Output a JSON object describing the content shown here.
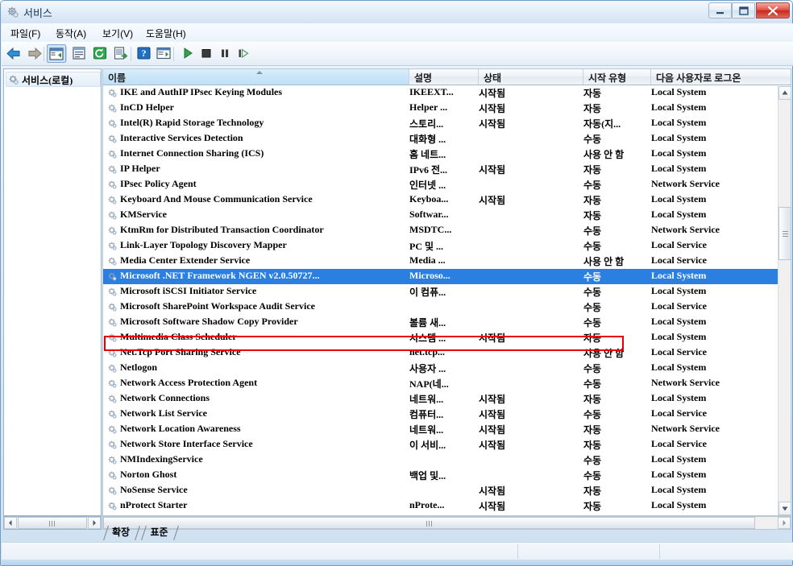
{
  "window": {
    "title": "서비스",
    "title_icon": "services-gear-icon",
    "buttons": {
      "minimize": "minimize-icon",
      "maximize": "maximize-icon",
      "close": "close-icon"
    }
  },
  "menubar": {
    "items": [
      {
        "label": "파일(F)",
        "name": "menu-file"
      },
      {
        "label": "동작(A)",
        "name": "menu-action"
      },
      {
        "label": "보기(V)",
        "name": "menu-view"
      },
      {
        "label": "도움말(H)",
        "name": "menu-help"
      }
    ]
  },
  "toolbar": {
    "buttons": [
      {
        "name": "back-button",
        "icon": "arrow-left-icon"
      },
      {
        "name": "forward-button",
        "icon": "arrow-right-icon"
      },
      {
        "name": "show-hide-tree-button",
        "icon": "tree-pane-icon"
      },
      {
        "name": "properties-button",
        "icon": "properties-icon"
      },
      {
        "name": "refresh-button",
        "icon": "refresh-icon"
      },
      {
        "name": "export-list-button",
        "icon": "export-list-icon"
      },
      {
        "name": "help-button",
        "icon": "help-question-icon"
      },
      {
        "name": "show-action-pane-button",
        "icon": "action-pane-icon"
      },
      {
        "name": "start-service-button",
        "icon": "play-icon"
      },
      {
        "name": "stop-service-button",
        "icon": "stop-icon"
      },
      {
        "name": "pause-service-button",
        "icon": "pause-icon"
      },
      {
        "name": "restart-service-button",
        "icon": "restart-icon"
      }
    ]
  },
  "tree": {
    "root_label": "서비스(로컬)",
    "root_icon": "services-gear-icon"
  },
  "list": {
    "columns": [
      {
        "label": "이름",
        "name": "column-name",
        "sorted": true
      },
      {
        "label": "설명",
        "name": "column-description",
        "sorted": false
      },
      {
        "label": "상태",
        "name": "column-status",
        "sorted": false
      },
      {
        "label": "시작 유형",
        "name": "column-startup-type",
        "sorted": false
      },
      {
        "label": "다음 사용자로 로그온",
        "name": "column-log-on-as",
        "sorted": false
      }
    ],
    "rows": [
      {
        "name": "IKE and AuthIP IPsec Keying Modules",
        "description": "IKEEXT...",
        "status": "시작됨",
        "startup": "자동",
        "logon": "Local System",
        "selected": false
      },
      {
        "name": "InCD Helper",
        "description": "Helper ...",
        "status": "시작됨",
        "startup": "자동",
        "logon": "Local System",
        "selected": false
      },
      {
        "name": "Intel(R) Rapid Storage Technology",
        "description": "스토리...",
        "status": "시작됨",
        "startup": "자동(지...",
        "logon": "Local System",
        "selected": false
      },
      {
        "name": "Interactive Services Detection",
        "description": "대화형 ...",
        "status": "",
        "startup": "수동",
        "logon": "Local System",
        "selected": false
      },
      {
        "name": "Internet Connection Sharing (ICS)",
        "description": "홈 네트...",
        "status": "",
        "startup": "사용 안 함",
        "logon": "Local System",
        "selected": false
      },
      {
        "name": "IP Helper",
        "description": "IPv6 전...",
        "status": "시작됨",
        "startup": "자동",
        "logon": "Local System",
        "selected": false
      },
      {
        "name": "IPsec Policy Agent",
        "description": "인터넷 ...",
        "status": "",
        "startup": "수동",
        "logon": "Network Service",
        "selected": false
      },
      {
        "name": "Keyboard And Mouse Communication Service",
        "description": "Keyboa...",
        "status": "시작됨",
        "startup": "자동",
        "logon": "Local System",
        "selected": false
      },
      {
        "name": "KMService",
        "description": "Softwar...",
        "status": "",
        "startup": "자동",
        "logon": "Local System",
        "selected": false
      },
      {
        "name": "KtmRm for Distributed Transaction Coordinator",
        "description": "MSDTC...",
        "status": "",
        "startup": "수동",
        "logon": "Network Service",
        "selected": false
      },
      {
        "name": "Link-Layer Topology Discovery Mapper",
        "description": "PC 및 ...",
        "status": "",
        "startup": "수동",
        "logon": "Local Service",
        "selected": false
      },
      {
        "name": "Media Center Extender Service",
        "description": "Media ...",
        "status": "",
        "startup": "사용 안 함",
        "logon": "Local Service",
        "selected": false
      },
      {
        "name": "Microsoft .NET Framework NGEN v2.0.50727...",
        "description": "Microso...",
        "status": "",
        "startup": "수동",
        "logon": "Local System",
        "selected": true
      },
      {
        "name": "Microsoft iSCSI Initiator Service",
        "description": "이 컴퓨...",
        "status": "",
        "startup": "수동",
        "logon": "Local System",
        "selected": false
      },
      {
        "name": "Microsoft SharePoint Workspace Audit Service",
        "description": "",
        "startup": "수동",
        "status": "",
        "logon": "Local Service",
        "selected": false
      },
      {
        "name": "Microsoft Software Shadow Copy Provider",
        "description": "볼륨 새...",
        "status": "",
        "startup": "수동",
        "logon": "Local System",
        "selected": false
      },
      {
        "name": "Multimedia Class Scheduler",
        "description": "시스템 ...",
        "status": "시작됨",
        "startup": "자동",
        "logon": "Local System",
        "selected": false
      },
      {
        "name": "Net.Tcp Port Sharing Service",
        "description": "net.tcp...",
        "status": "",
        "startup": "사용 안 함",
        "logon": "Local Service",
        "selected": false
      },
      {
        "name": "Netlogon",
        "description": "사용자 ...",
        "status": "",
        "startup": "수동",
        "logon": "Local System",
        "selected": false
      },
      {
        "name": "Network Access Protection Agent",
        "description": "NAP(네...",
        "status": "",
        "startup": "수동",
        "logon": "Network Service",
        "selected": false
      },
      {
        "name": "Network Connections",
        "description": "네트워...",
        "status": "시작됨",
        "startup": "자동",
        "logon": "Local System",
        "selected": false
      },
      {
        "name": "Network List Service",
        "description": "컴퓨터...",
        "status": "시작됨",
        "startup": "수동",
        "logon": "Local Service",
        "selected": false
      },
      {
        "name": "Network Location Awareness",
        "description": "네트워...",
        "status": "시작됨",
        "startup": "자동",
        "logon": "Network Service",
        "selected": false
      },
      {
        "name": "Network Store Interface Service",
        "description": "이 서비...",
        "status": "시작됨",
        "startup": "자동",
        "logon": "Local Service",
        "selected": false
      },
      {
        "name": "NMIndexingService",
        "description": "",
        "status": "",
        "startup": "수동",
        "logon": "Local System",
        "selected": false
      },
      {
        "name": "Norton Ghost",
        "description": "백업 및...",
        "status": "",
        "startup": "수동",
        "logon": "Local System",
        "selected": false
      },
      {
        "name": "NoSense Service",
        "description": "",
        "status": "시작됨",
        "startup": "자동",
        "logon": "Local System",
        "selected": false
      },
      {
        "name": "nProtect Starter",
        "description": "nProte...",
        "status": "시작됨",
        "startup": "자동",
        "logon": "Local System",
        "selected": false
      }
    ]
  },
  "tabs": [
    {
      "label": "확장",
      "name": "tab-extended",
      "active": false
    },
    {
      "label": "표준",
      "name": "tab-standard",
      "active": true
    }
  ],
  "annotation": {
    "color": "#e80000",
    "target_row": "Microsoft .NET Framework NGEN v2.0.50727..."
  },
  "colors": {
    "selection": "#2a7fe0",
    "header_sorted": "#c9e6f9",
    "annotation": "#e80000"
  }
}
